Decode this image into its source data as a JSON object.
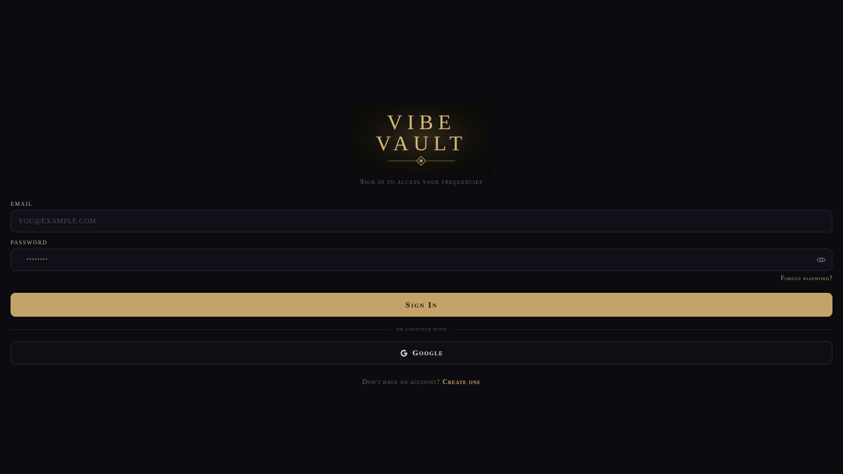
{
  "logo": {
    "line1": "VIBE",
    "line2": "VAULT",
    "gold": "#d8b878"
  },
  "subtitle": "Sign in to access your frequencies",
  "form": {
    "email_label": "EMAIL",
    "email_placeholder": "you@example.com",
    "password_label": "PASSWORD",
    "password_masked": "••••••••",
    "password_toggle_icon": "eye-icon",
    "forgot_label": "Forgot password?",
    "submit_label": "Sign In"
  },
  "divider_text": "or continue with",
  "google": {
    "icon": "google-icon",
    "label": "Google"
  },
  "signup": {
    "prompt": "Don't have an account?",
    "link_label": "Create one"
  },
  "colors": {
    "background": "#0b0b10",
    "accent": "#c4a36a",
    "link": "#c7a46a"
  }
}
